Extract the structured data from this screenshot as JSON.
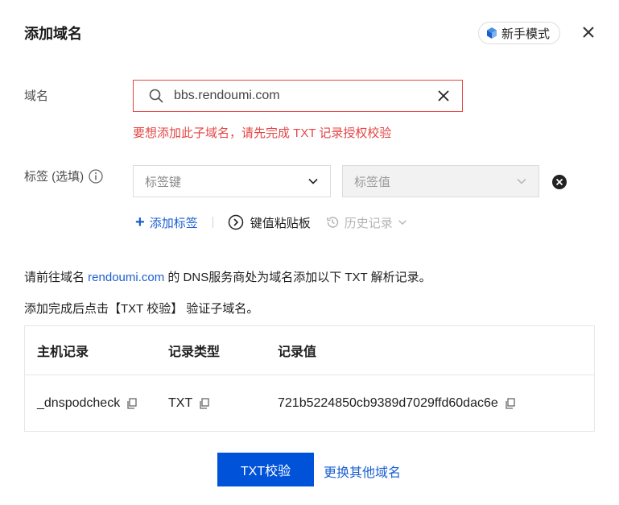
{
  "dialog": {
    "title": "添加域名",
    "newbie_mode_label": "新手模式"
  },
  "form": {
    "domain_label": "域名",
    "domain_value": "bbs.rendoumi.com",
    "domain_error": "要想添加此子域名，请先完成 TXT 记录授权校验",
    "tag_label": "标签 (选填)",
    "tag_key_placeholder": "标签键",
    "tag_value_placeholder": "标签值",
    "add_tag_label": "添加标签",
    "paste_board_label": "键值粘贴板",
    "history_label": "历史记录"
  },
  "instructions": {
    "line1_prefix": "请前往域名 ",
    "line1_domain": "rendoumi.com",
    "line1_suffix": " 的 DNS服务商处为域名添加以下 TXT 解析记录。",
    "line2": "添加完成后点击【TXT 校验】 验证子域名。"
  },
  "record_table": {
    "columns": [
      "主机记录",
      "记录类型",
      "记录值"
    ],
    "rows": [
      [
        "_dnspodcheck",
        "TXT",
        "721b5224850cb9389d7029ffd60dac6e"
      ]
    ]
  },
  "footer": {
    "verify_button": "TXT校验",
    "switch_domain_link": "更换其他域名"
  },
  "colors": {
    "primary": "#0052d9",
    "link": "#1a5fd0",
    "error": "#e54545"
  },
  "icons": [
    "cube-icon",
    "close-icon",
    "search-icon",
    "clear-icon",
    "info-icon",
    "chevron-down-icon",
    "remove-circle-icon",
    "plus-icon",
    "paste-board-icon",
    "history-icon",
    "copy-icon"
  ]
}
